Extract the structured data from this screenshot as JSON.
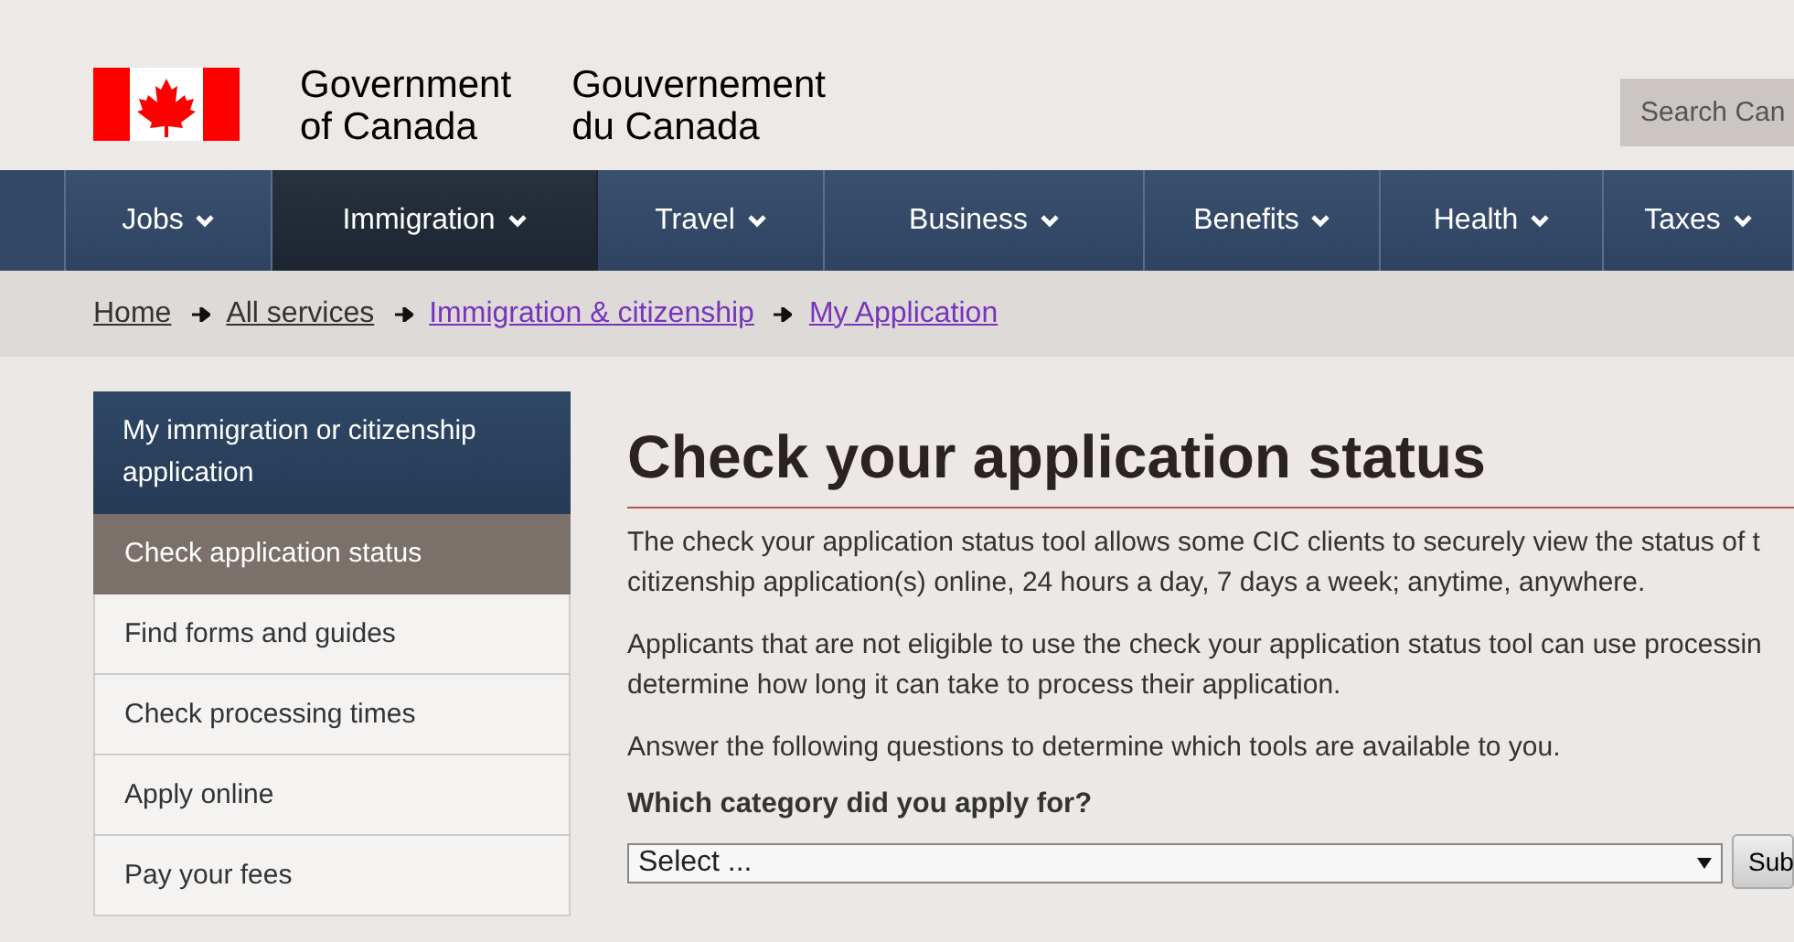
{
  "header": {
    "name_en": [
      "Government",
      "of Canada"
    ],
    "name_fr": [
      "Gouvernement",
      "du Canada"
    ],
    "search": {
      "placeholder": "Search Can"
    }
  },
  "nav": [
    {
      "label": "Jobs",
      "selected": false
    },
    {
      "label": "Immigration",
      "selected": true
    },
    {
      "label": "Travel",
      "selected": false
    },
    {
      "label": "Business",
      "selected": false
    },
    {
      "label": "Benefits",
      "selected": false
    },
    {
      "label": "Health",
      "selected": false
    },
    {
      "label": "Taxes",
      "selected": false
    }
  ],
  "breadcrumb": [
    {
      "label": "Home",
      "visited": false
    },
    {
      "label": "All services",
      "visited": false
    },
    {
      "label": "Immigration & citizenship",
      "visited": true
    },
    {
      "label": "My Application",
      "visited": true
    }
  ],
  "sidebar": {
    "title": "My immigration or citizenship application",
    "items": [
      {
        "label": "Check application status",
        "selected": true
      },
      {
        "label": "Find forms and guides",
        "selected": false
      },
      {
        "label": "Check processing times",
        "selected": false
      },
      {
        "label": "Apply online",
        "selected": false
      },
      {
        "label": "Pay your fees",
        "selected": false
      }
    ]
  },
  "main": {
    "title": "Check your application status",
    "paragraphs": [
      [
        "The check your application status tool allows some CIC clients to securely view the status of t",
        "citizenship application(s) online, 24 hours a day, 7 days a week; anytime, anywhere."
      ],
      [
        "Applicants that are not eligible to use the check your application status tool can use processin",
        "determine how long it can take to process their application."
      ],
      [
        "Answer the following questions to determine which tools are available to you."
      ]
    ],
    "question": "Which category did you apply for?",
    "select": {
      "value": "Select ..."
    },
    "submit": "Sub"
  }
}
